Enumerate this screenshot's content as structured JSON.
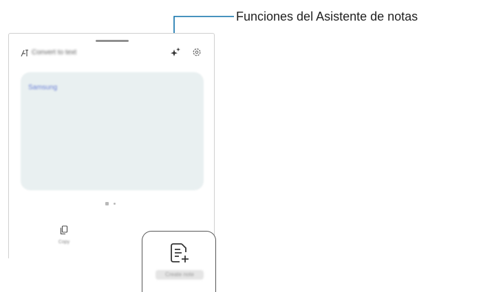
{
  "panel": {
    "title": "Convert to text",
    "note_text": "Samsung",
    "copy_label": "Copy",
    "create_label": "Create note"
  },
  "callout": {
    "label": "Funciones del Asistente de notas",
    "color": "#0a6ea8"
  },
  "icons": {
    "title_icon": "text-convert-icon",
    "assistant_icon": "sparkle-icon",
    "settings_icon": "gear-icon",
    "copy_icon": "copy-icon",
    "create_icon": "note-add-icon"
  }
}
